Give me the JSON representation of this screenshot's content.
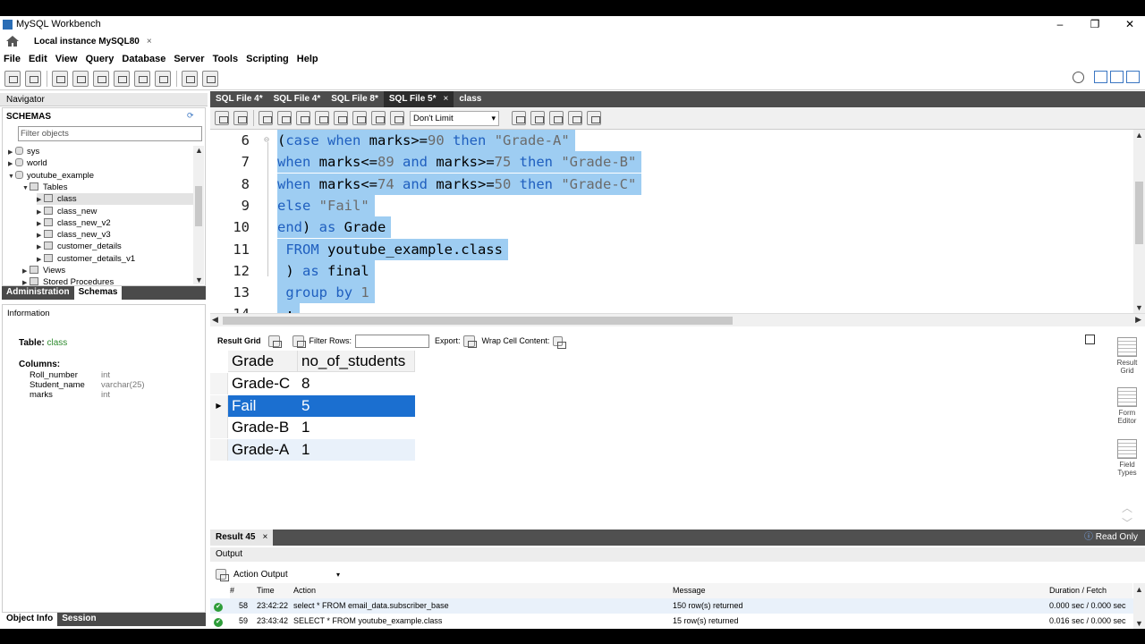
{
  "window": {
    "title": "MySQL Workbench",
    "minimize": "–",
    "restore": "❐",
    "close": "✕"
  },
  "connection_tab": {
    "label": "Local instance MySQL80",
    "close": "×"
  },
  "menu": [
    "File",
    "Edit",
    "View",
    "Query",
    "Database",
    "Server",
    "Tools",
    "Scripting",
    "Help"
  ],
  "navigator": {
    "header": "Navigator",
    "schemas_label": "SCHEMAS",
    "filter_placeholder": "Filter objects",
    "tree": [
      {
        "label": "sys",
        "level": 0,
        "kind": "db",
        "expanded": false
      },
      {
        "label": "world",
        "level": 0,
        "kind": "db",
        "expanded": false
      },
      {
        "label": "youtube_example",
        "level": 0,
        "kind": "db",
        "expanded": true
      },
      {
        "label": "Tables",
        "level": 1,
        "kind": "folder",
        "expanded": true
      },
      {
        "label": "class",
        "level": 2,
        "kind": "table",
        "selected": true
      },
      {
        "label": "class_new",
        "level": 2,
        "kind": "table"
      },
      {
        "label": "class_new_v2",
        "level": 2,
        "kind": "table"
      },
      {
        "label": "class_new_v3",
        "level": 2,
        "kind": "table"
      },
      {
        "label": "customer_details",
        "level": 2,
        "kind": "table"
      },
      {
        "label": "customer_details_v1",
        "level": 2,
        "kind": "table"
      },
      {
        "label": "Views",
        "level": 1,
        "kind": "folder"
      },
      {
        "label": "Stored Procedures",
        "level": 1,
        "kind": "folder"
      }
    ],
    "tabs": [
      "Administration",
      "Schemas"
    ],
    "active_tab": "Schemas"
  },
  "information": {
    "header": "Information",
    "table_label": "Table:",
    "table_name": "class",
    "columns_label": "Columns:",
    "columns": [
      {
        "name": "Roll_number",
        "type": "int"
      },
      {
        "name": "Student_name",
        "type": "varchar(25)"
      },
      {
        "name": "marks",
        "type": "int"
      }
    ],
    "bottom_tabs": [
      "Object Info",
      "Session"
    ]
  },
  "editor_tabs": [
    {
      "label": "SQL File 4*",
      "active": false
    },
    {
      "label": "SQL File 4*",
      "active": false
    },
    {
      "label": "SQL File 8*",
      "active": false
    },
    {
      "label": "SQL File 5*",
      "active": true,
      "close": "×"
    },
    {
      "label": "class",
      "active": false
    }
  ],
  "editor_toolbar": {
    "limit": "Don't Limit"
  },
  "code_lines": [
    {
      "n": "6",
      "tokens": [
        [
          "p",
          "("
        ],
        [
          "k",
          "case"
        ],
        [
          "p",
          " "
        ],
        [
          "k",
          "when"
        ],
        [
          "p",
          " marks>="
        ],
        [
          "n",
          "90"
        ],
        [
          "p",
          " "
        ],
        [
          "k",
          "then"
        ],
        [
          "p",
          " "
        ],
        [
          "s",
          "\"Grade-A\""
        ]
      ]
    },
    {
      "n": "7",
      "tokens": [
        [
          "k",
          "when"
        ],
        [
          "p",
          " marks<="
        ],
        [
          "n",
          "89"
        ],
        [
          "p",
          " "
        ],
        [
          "k",
          "and"
        ],
        [
          "p",
          " marks>="
        ],
        [
          "n",
          "75"
        ],
        [
          "p",
          " "
        ],
        [
          "k",
          "then"
        ],
        [
          "p",
          " "
        ],
        [
          "s",
          "\"Grade-B\""
        ]
      ]
    },
    {
      "n": "8",
      "tokens": [
        [
          "k",
          "when"
        ],
        [
          "p",
          " marks<="
        ],
        [
          "n",
          "74"
        ],
        [
          "p",
          " "
        ],
        [
          "k",
          "and"
        ],
        [
          "p",
          " marks>="
        ],
        [
          "n",
          "50"
        ],
        [
          "p",
          " "
        ],
        [
          "k",
          "then"
        ],
        [
          "p",
          " "
        ],
        [
          "s",
          "\"Grade-C\""
        ]
      ]
    },
    {
      "n": "9",
      "tokens": [
        [
          "k",
          "else"
        ],
        [
          "p",
          " "
        ],
        [
          "s",
          "\"Fail\""
        ]
      ]
    },
    {
      "n": "10",
      "tokens": [
        [
          "k",
          "end"
        ],
        [
          "p",
          ") "
        ],
        [
          "k",
          "as"
        ],
        [
          "p",
          " Grade"
        ]
      ]
    },
    {
      "n": "11",
      "tokens": [
        [
          "p",
          " "
        ],
        [
          "k",
          "FROM"
        ],
        [
          "p",
          " youtube_example.class"
        ]
      ]
    },
    {
      "n": "12",
      "tokens": [
        [
          "p",
          " ) "
        ],
        [
          "k",
          "as"
        ],
        [
          "p",
          " final"
        ]
      ]
    },
    {
      "n": "13",
      "tokens": [
        [
          "p",
          " "
        ],
        [
          "k",
          "group"
        ],
        [
          "p",
          " "
        ],
        [
          "k",
          "by"
        ],
        [
          "p",
          " "
        ],
        [
          "n",
          "1"
        ]
      ]
    },
    {
      "n": "14",
      "tokens": [
        [
          "p",
          " ;"
        ]
      ]
    }
  ],
  "result_toolbar": {
    "result_grid": "Result Grid",
    "filter_rows": "Filter Rows:",
    "export": "Export:",
    "wrap": "Wrap Cell Content:"
  },
  "result_grid": {
    "columns": [
      "Grade",
      "no_of_students"
    ],
    "rows": [
      [
        "Grade-C",
        "8"
      ],
      [
        "Fail",
        "5"
      ],
      [
        "Grade-B",
        "1"
      ],
      [
        "Grade-A",
        "1"
      ]
    ],
    "selected_row": 1
  },
  "side_buttons": [
    {
      "line1": "Result",
      "line2": "Grid"
    },
    {
      "line1": "Form",
      "line2": "Editor"
    },
    {
      "line1": "Field",
      "line2": "Types"
    }
  ],
  "result_tab": {
    "label": "Result 45",
    "close": "×",
    "read_only": "Read Only"
  },
  "output": {
    "header": "Output",
    "mode": "Action Output",
    "columns": [
      "#",
      "Time",
      "Action",
      "Message",
      "Duration / Fetch"
    ],
    "rows": [
      {
        "num": "58",
        "time": "23:42:22",
        "action": "select  * FROM email_data.subscriber_base",
        "message": "150 row(s) returned",
        "duration": "0.000 sec / 0.000 sec"
      },
      {
        "num": "59",
        "time": "23:43:42",
        "action": "SELECT * FROM youtube_example.class",
        "message": "15 row(s) returned",
        "duration": "0.016 sec / 0.000 sec"
      }
    ]
  },
  "colors": {
    "selection": "#1b6fd0",
    "code_highlight": "#9ecdf2",
    "keyword": "#1f5fbf",
    "tab_bar": "#4d4d4d"
  }
}
